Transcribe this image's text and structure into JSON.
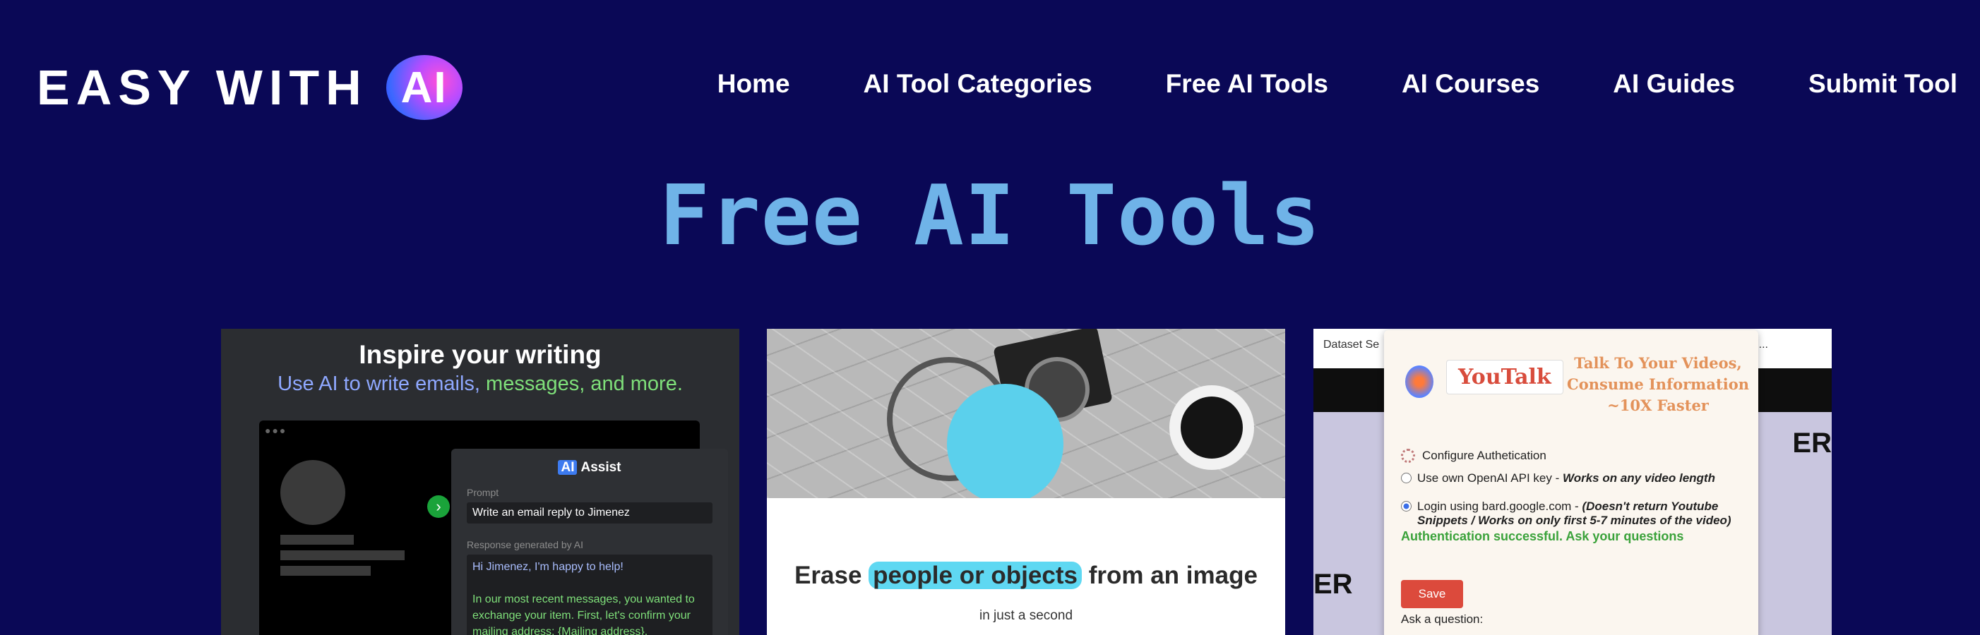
{
  "header": {
    "logo_text": "EASY WITH",
    "logo_badge": "AI",
    "nav": [
      "Home",
      "AI Tool Categories",
      "Free AI Tools",
      "AI Courses",
      "AI Guides",
      "Submit Tool"
    ]
  },
  "page": {
    "title": "Free AI Tools"
  },
  "cards": {
    "writing": {
      "headline": "Inspire your writing",
      "subline_a": "Use AI to write emails, ",
      "subline_b": "messages, and more.",
      "assist_badge": "AI",
      "assist_label": "Assist",
      "prompt_label": "Prompt",
      "prompt_value": "Write an email reply to Jimenez",
      "response_label": "Response generated by AI",
      "response_greeting": "Hi Jimenez, I'm happy to help!",
      "response_body": "In our most recent messages, you wanted to exchange your item. First, let's confirm your mailing address: {Mailing address}."
    },
    "erase": {
      "headline_pre": "Erase",
      "headline_highlight": "people or objects",
      "headline_post": "from an image",
      "subline": "in just a second"
    },
    "youtalk": {
      "tab_left": "Dataset Se",
      "tab_right": "raph...",
      "bg_text_right": "ER",
      "bg_text_left": "ER",
      "brand": "YouTalk",
      "tagline": "Talk To Your Videos, Consume Information ~10X Faster",
      "configure": "Configure Authetication",
      "option1": "Use own OpenAI API key - ",
      "option1_em": "Works on any video length",
      "option2": "Login using bard.google.com - ",
      "option2_em": "(Doesn't return Youtube Snippets / Works on only first 5-7 minutes of the video)",
      "status": "Authentication successful. Ask your questions",
      "save": "Save",
      "ask": "Ask a question:"
    }
  },
  "colors": {
    "background": "#0a0856",
    "title": "#6fb3e8",
    "nav_text": "#ffffff"
  }
}
